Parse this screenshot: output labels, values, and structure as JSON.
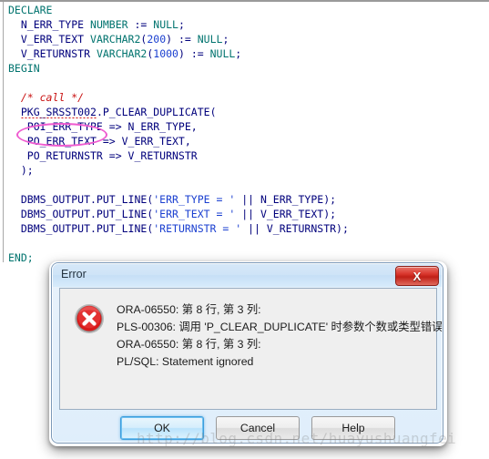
{
  "editor": {
    "language": "PL/SQL",
    "lines": [
      {
        "id": "l1",
        "text": "DECLARE"
      },
      {
        "id": "l2",
        "text": "  N_ERR_TYPE NUMBER := NULL;"
      },
      {
        "id": "l3",
        "text": "  V_ERR_TEXT VARCHAR2(200) := NULL;"
      },
      {
        "id": "l4",
        "text": "  V_RETURNSTR VARCHAR2(1000) := NULL;"
      },
      {
        "id": "l5",
        "text": "BEGIN"
      },
      {
        "id": "l6",
        "text": ""
      },
      {
        "id": "l7",
        "text": "  /* call */"
      },
      {
        "id": "l8",
        "text": "  PKG_SRSST002.P_CLEAR_DUPLICATE("
      },
      {
        "id": "l9",
        "text": "   POI_ERR_TYPE => N_ERR_TYPE,"
      },
      {
        "id": "l10",
        "text": "   PO_ERR_TEXT => V_ERR_TEXT,"
      },
      {
        "id": "l11",
        "text": "   PO_RETURNSTR => V_RETURNSTR"
      },
      {
        "id": "l12",
        "text": "  );"
      },
      {
        "id": "l13",
        "text": ""
      },
      {
        "id": "l14",
        "text": "  DBMS_OUTPUT.PUT_LINE('ERR_TYPE = ' || N_ERR_TYPE);"
      },
      {
        "id": "l15",
        "text": "  DBMS_OUTPUT.PUT_LINE('ERR_TEXT = ' || V_ERR_TEXT);"
      },
      {
        "id": "l16",
        "text": "  DBMS_OUTPUT.PUT_LINE('RETURNSTR = ' || V_RETURNSTR);"
      },
      {
        "id": "l17",
        "text": ""
      },
      {
        "id": "l18",
        "text": "END;"
      }
    ],
    "tokens": {
      "kw_declare": "DECLARE",
      "kw_begin": "BEGIN",
      "kw_end": "END;",
      "kw_number": "NUMBER",
      "kw_varchar2": "VARCHAR2",
      "kw_null": "NULL",
      "comment": "/* call */",
      "highlighted_param": "POI_ERR_TYPE",
      "package_call": "PKG_SRSST002.P_CLEAR_DUPLICATE"
    },
    "colors": {
      "keyword": "#00736e",
      "identifier": "#00007c",
      "number": "#1a3fd0",
      "string": "#1a3fd0",
      "comment": "#c81010",
      "annotation_ellipse": "#ef5bd0",
      "error_squiggle": "#d01010"
    }
  },
  "dialog": {
    "title": "Error",
    "close_label": "X",
    "icon": "error-circle-x-icon",
    "message_lines": [
      "ORA-06550: 第 8 行, 第 3 列:",
      "PLS-00306: 调用 'P_CLEAR_DUPLICATE' 时参数个数或类型错误",
      "ORA-06550: 第 8 行, 第 3 列:",
      "PL/SQL: Statement ignored"
    ],
    "buttons": {
      "ok": "OK",
      "cancel": "Cancel",
      "help": "Help"
    }
  },
  "watermark": {
    "text": "http://blog.csdn.net/huayushuangfei"
  }
}
